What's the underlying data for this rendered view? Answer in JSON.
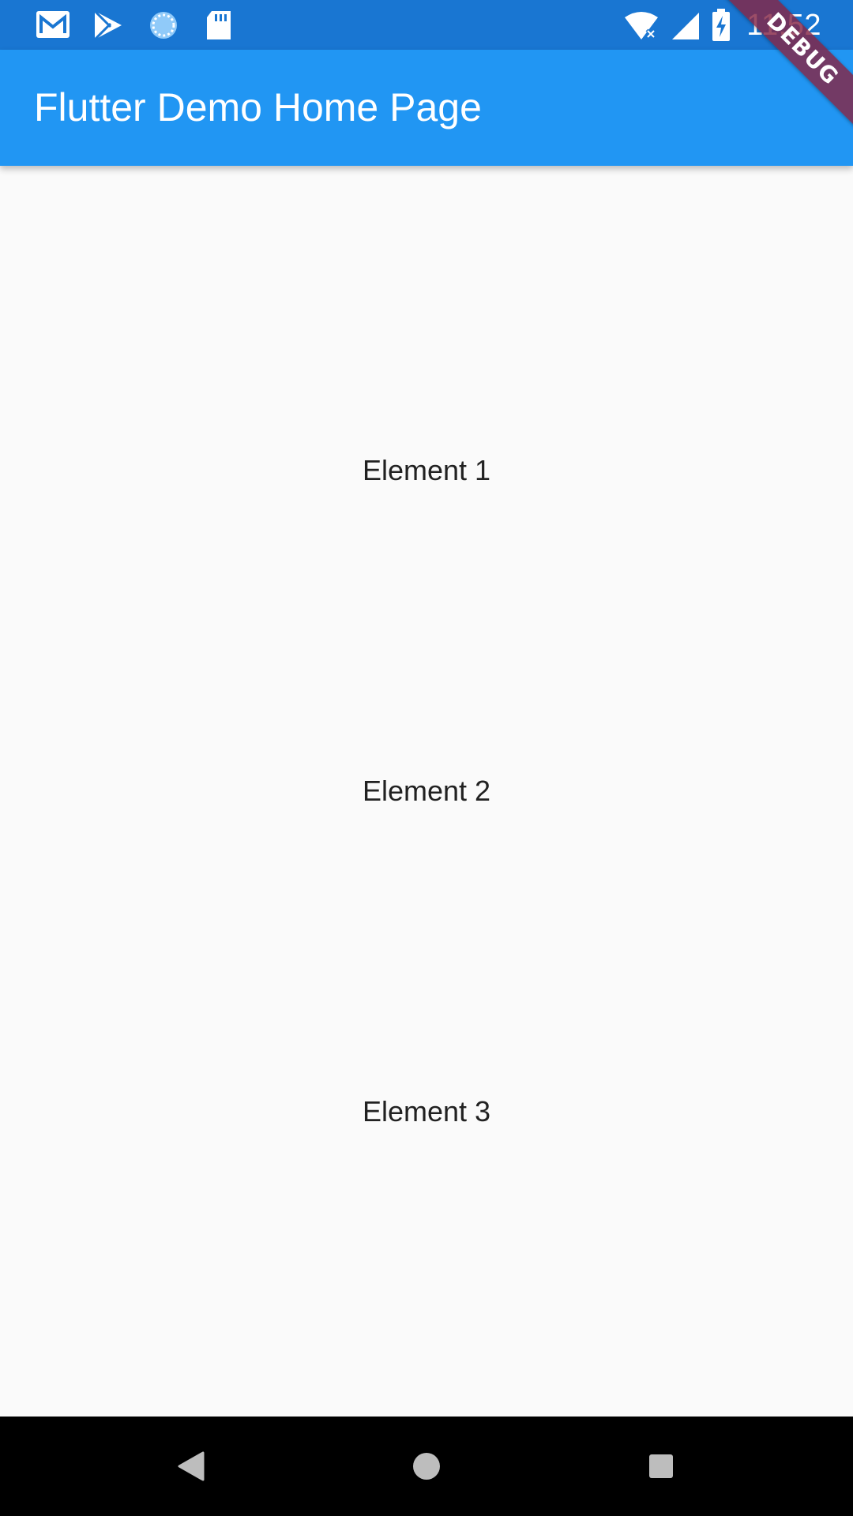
{
  "status_bar": {
    "time": "11:52",
    "left_icons": [
      "mail-icon",
      "play-store-icon",
      "sync-icon",
      "sd-card-icon"
    ],
    "right_icons": [
      "wifi-icon",
      "signal-icon",
      "battery-charging-icon"
    ]
  },
  "debug_banner": {
    "label": "DEBUG",
    "color": "#852646"
  },
  "app_bar": {
    "title": "Flutter Demo Home Page",
    "color": "#2196f3"
  },
  "body": {
    "elements": [
      {
        "label": "Element 1"
      },
      {
        "label": "Element 2"
      },
      {
        "label": "Element 3"
      }
    ]
  },
  "nav_bar": {
    "buttons": [
      "back-icon",
      "home-icon",
      "recents-icon"
    ]
  },
  "colors": {
    "status_bar": "#1976d2",
    "background": "#fafafa",
    "text": "#212121",
    "nav_bar": "#000000"
  }
}
